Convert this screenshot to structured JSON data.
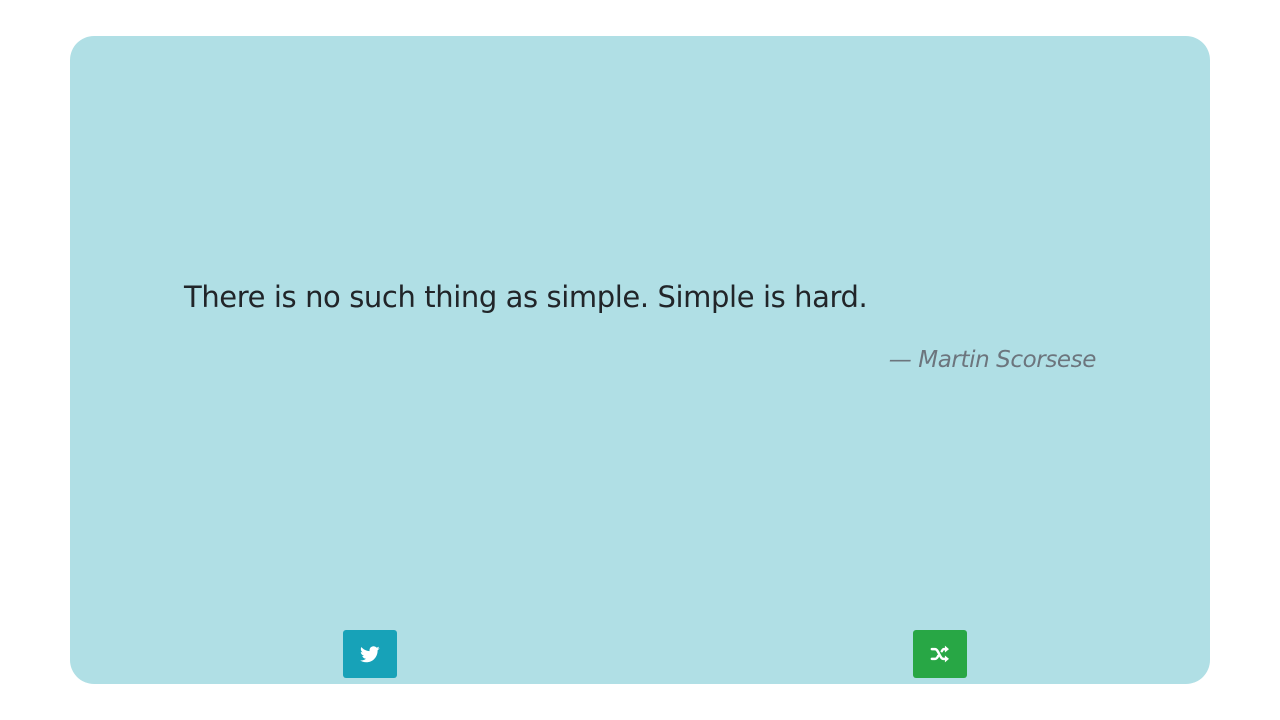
{
  "quote": {
    "text": "There is no such thing as simple. Simple is hard.",
    "author": "— Martin Scorsese"
  },
  "buttons": {
    "tweet": {
      "icon": "twitter-icon",
      "color": "#17a2b8"
    },
    "new_quote": {
      "icon": "shuffle-icon",
      "color": "#28a745"
    }
  },
  "colors": {
    "card_background": "#b0dfe5",
    "page_background": "#ffffff",
    "quote_text": "#212529",
    "author_text": "#6c757d"
  }
}
